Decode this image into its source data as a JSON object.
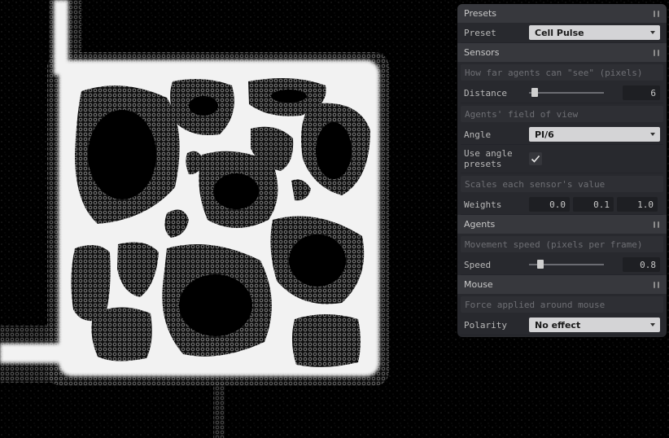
{
  "simulation": {
    "background_color": "#000000",
    "trail_color": "#ffffff"
  },
  "panel": {
    "folders": {
      "presets": {
        "title": "Presets",
        "preset_label": "Preset",
        "preset_value": "Cell Pulse"
      },
      "sensors": {
        "title": "Sensors",
        "distance_hint": "How far agents can \"see\" (pixels)",
        "distance_label": "Distance",
        "distance_value": "6",
        "distance_fraction": 0.03,
        "fov_hint": "Agents' field of view",
        "angle_label": "Angle",
        "angle_value": "PI/6",
        "use_presets_label": "Use angle presets",
        "use_presets_checked": true,
        "weights_hint": "Scales each sensor's value",
        "weights_label": "Weights",
        "weights": [
          "0.0",
          "0.1",
          "1.0"
        ]
      },
      "agents": {
        "title": "Agents",
        "speed_hint": "Movement speed (pixels per frame)",
        "speed_label": "Speed",
        "speed_value": "0.8",
        "speed_fraction": 0.12
      },
      "mouse": {
        "title": "Mouse",
        "force_hint": "Force applied around mouse",
        "polarity_label": "Polarity",
        "polarity_value": "No effect"
      }
    },
    "icons": {
      "folder_toggle": "pause-bars-icon",
      "dropdown": "caret-down-icon",
      "checkbox": "checkmark-icon"
    }
  }
}
